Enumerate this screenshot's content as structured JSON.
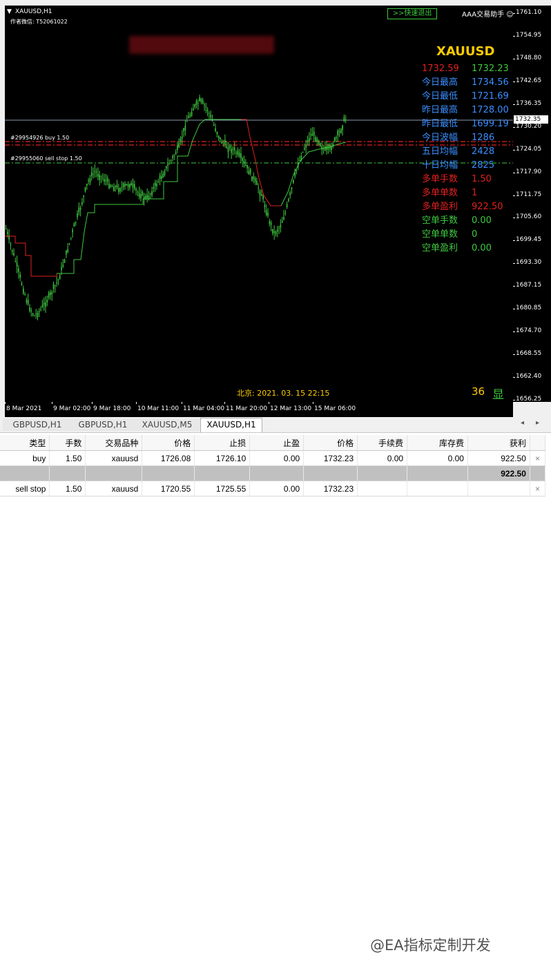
{
  "chart": {
    "title": "XAUUSD,H1",
    "author": "作者微信:  T52061022",
    "exit_button": ">>快速退出",
    "assistant_label": "AAA交易助手",
    "assistant_icon": "smiley-icon",
    "symbol_big": "XAUUSD",
    "beijing_time": "北京: 2021. 03. 15  22:15",
    "count": "36",
    "show_label": "显",
    "current_price": "1732.35",
    "order_labels": [
      "#29954926 buy 1.50",
      "#29955060 sell stop 1.50"
    ],
    "price_ticks": [
      "1761.10",
      "1754.95",
      "1748.80",
      "1742.65",
      "1736.35",
      "1730.20",
      "1724.05",
      "1717.90",
      "1711.75",
      "1705.60",
      "1699.45",
      "1693.30",
      "1687.15",
      "1680.85",
      "1674.70",
      "1668.55",
      "1662.40",
      "1656.25"
    ],
    "time_ticks": [
      "8 Mar 2021",
      "9 Mar 02:00",
      "9 Mar 18:00",
      "10 Mar 11:00",
      "11 Mar 04:00",
      "11 Mar 20:00",
      "12 Mar 13:00",
      "15 Mar 06:00"
    ],
    "colors": {
      "red": "#e02020",
      "green": "#3fc83f",
      "blue": "#3a8eff",
      "yellow": "#ffcc00"
    }
  },
  "info_panel": [
    {
      "key": "1732.59",
      "value": "1732.23",
      "kc": "red",
      "vc": "green"
    },
    {
      "key": "今日最高",
      "value": "1734.56",
      "kc": "blue",
      "vc": "blue"
    },
    {
      "key": "今日最低",
      "value": "1721.69",
      "kc": "blue",
      "vc": "blue"
    },
    {
      "key": "昨日最高",
      "value": "1728.00",
      "kc": "blue",
      "vc": "blue"
    },
    {
      "key": "昨日最低",
      "value": "1699.19",
      "kc": "blue",
      "vc": "blue"
    },
    {
      "key": "今日波幅",
      "value": "1286",
      "kc": "blue",
      "vc": "blue"
    },
    {
      "key": "五日均幅",
      "value": "2428",
      "kc": "blue",
      "vc": "blue"
    },
    {
      "key": "十日均幅",
      "value": "2825",
      "kc": "blue",
      "vc": "blue"
    },
    {
      "key": "多单手数",
      "value": "1.50",
      "kc": "red",
      "vc": "red"
    },
    {
      "key": "多单单数",
      "value": "1",
      "kc": "red",
      "vc": "red"
    },
    {
      "key": "多单盈利",
      "value": "922.50",
      "kc": "red",
      "vc": "red"
    },
    {
      "key": "空单手数",
      "value": "0.00",
      "kc": "green",
      "vc": "green"
    },
    {
      "key": "空单单数",
      "value": "0",
      "kc": "green",
      "vc": "green"
    },
    {
      "key": "空单盈利",
      "value": "0.00",
      "kc": "green",
      "vc": "green"
    }
  ],
  "tabs": [
    "GBPUSD,H1",
    "GBPUSD,H1",
    "XAUUSD,M5",
    "XAUUSD,H1"
  ],
  "active_tab": 3,
  "terminal": {
    "headers": [
      "类型",
      "手数",
      "交易品种",
      "价格",
      "止损",
      "止盈",
      "价格",
      "手续费",
      "库存费",
      "获利",
      ""
    ],
    "rows": [
      [
        "buy",
        "1.50",
        "xauusd",
        "1726.08",
        "1726.10",
        "0.00",
        "1732.23",
        "0.00",
        "0.00",
        "922.50",
        "×"
      ],
      [
        "",
        "",
        "",
        "",
        "",
        "",
        "",
        "",
        "",
        "922.50",
        ""
      ],
      [
        "sell stop",
        "1.50",
        "xauusd",
        "1720.55",
        "1725.55",
        "0.00",
        "1732.23",
        "",
        "",
        "",
        "×"
      ]
    ]
  },
  "watermark": "@EA指标定制开发"
}
